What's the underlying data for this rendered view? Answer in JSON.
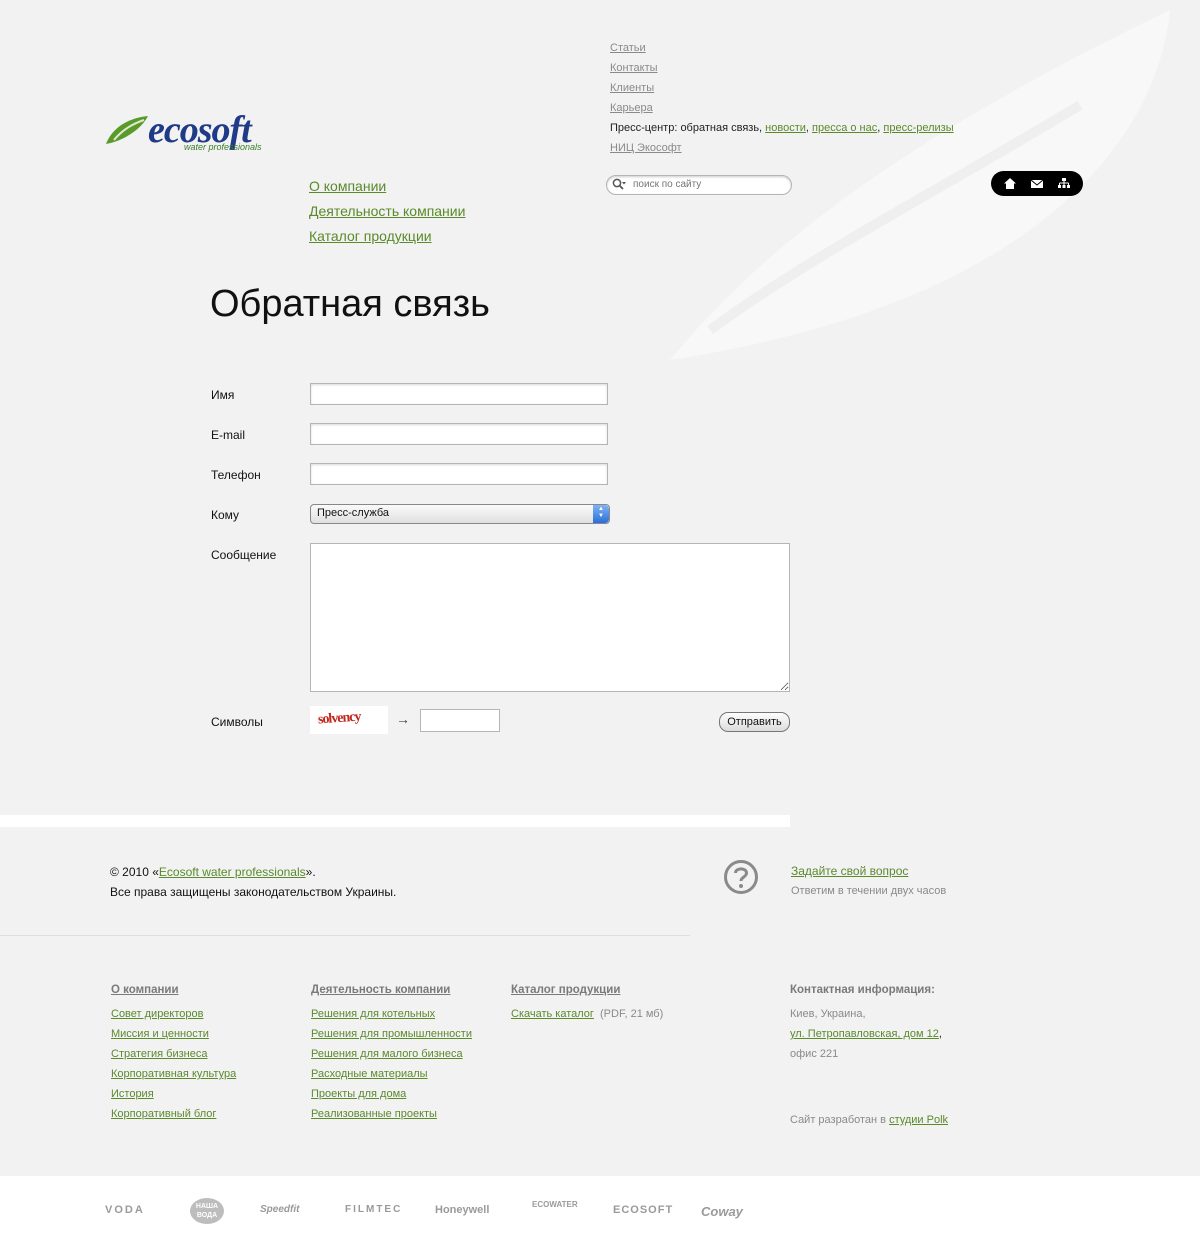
{
  "logo": {
    "word": "ecosoft",
    "tagline": "water professionals"
  },
  "top_menu": {
    "articles": "Статьи",
    "contacts": "Контакты",
    "clients": "Клиенты",
    "career": "Карьера",
    "press_prefix": "Пресс-центр: обратная связь,",
    "news": "новости",
    "press_about": "пресса о нас",
    "press_releases": "пресс-релизы",
    "research": "НИЦ Экософт"
  },
  "main_menu": [
    "О компании",
    "Деятельность компании",
    "Каталог продукции"
  ],
  "search": {
    "placeholder": "поиск по сайту"
  },
  "page_title": "Обратная связь",
  "form": {
    "name_label": "Имя",
    "email_label": "E-mail",
    "phone_label": "Телефон",
    "to_label": "Кому",
    "to_value": "Пресс-служба",
    "message_label": "Сообщение",
    "captcha_label": "Символы",
    "captcha_text": "solvency",
    "arrow": "→",
    "submit_label": "Отправить"
  },
  "footer": {
    "copy_prefix": "© 2010 «",
    "copy_link": "Ecosoft water professionals",
    "copy_suffix": "».",
    "rights": "Все права защищены законодательством Украины.",
    "ask_link": "Задайте свой вопрос",
    "ask_sub": "Ответим в течении двух часов"
  },
  "columns": {
    "company": {
      "head": "О компании",
      "items": [
        "Совет директоров",
        "Миссия и ценности",
        "Стратегия бизнеса",
        "Корпоративная культура",
        "История",
        "Корпоративный блог"
      ]
    },
    "activity": {
      "head": "Деятельность компании",
      "items": [
        "Решения для котельных",
        "Решения для промышленности",
        "Решения для малого бизнеса",
        "Расходные материалы",
        "Проекты для дома",
        "Реализованные проекты"
      ]
    },
    "catalog": {
      "head": "Каталог продукции",
      "download": "Скачать каталог",
      "size": "(PDF, 21 мб)"
    },
    "contact": {
      "head": "Контактная информация:",
      "city": "Киев, Украина,",
      "street": "ул. Петропавловская, дом 12",
      "office": "офис 221",
      "dev_prefix": "Сайт разработан в",
      "dev_link": "студии Polk"
    }
  },
  "partners": [
    "VODA",
    "НАША ВОДА",
    "Speedfit",
    "FILMTEC",
    "Honeywell",
    "ECOWATER",
    "ECOSOFT",
    "Coway"
  ],
  "colors": {
    "link_green": "#5a8a2b",
    "logo_blue": "#1f3b87",
    "background": "#f2f2f2"
  }
}
